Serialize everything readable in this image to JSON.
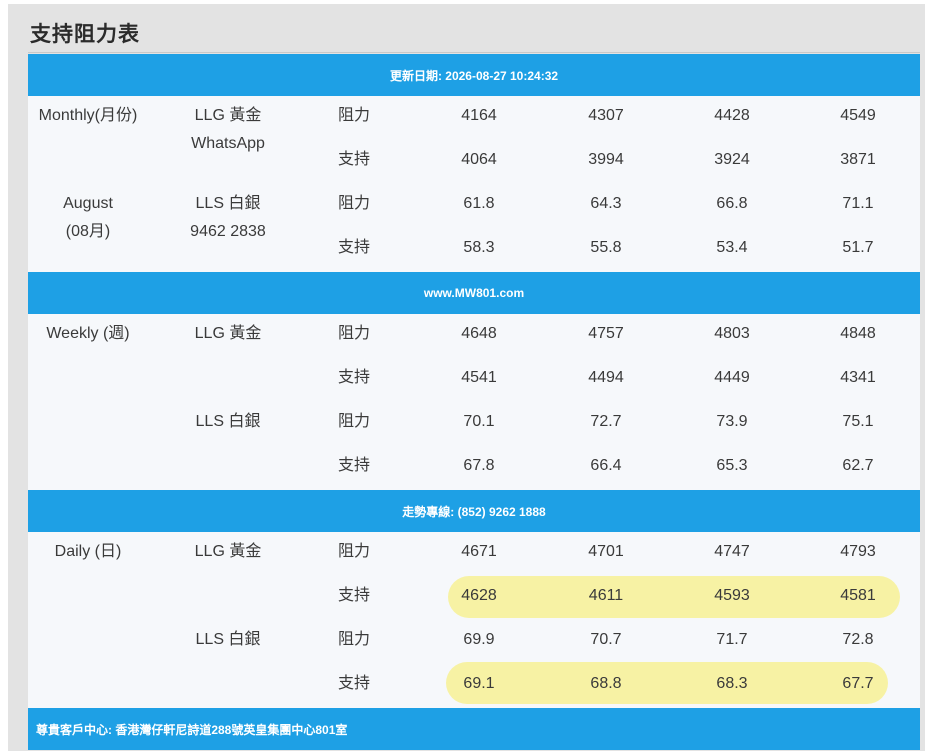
{
  "title": "支持阻力表",
  "banners": {
    "update": "更新日期: 2026-08-27 10:24:32",
    "website": "www.MW801.com",
    "hotline": "走勢專線: (852) 9262 1888",
    "address": "尊貴客戶中心: 香港灣仔軒尼詩道288號英皇集團中心801室"
  },
  "monthly": {
    "period_line1": "Monthly(月份)",
    "period_line2": "August",
    "period_line3": "(08月)",
    "gold_label": "LLG 黃金",
    "whatsapp_label": "WhatsApp",
    "silver_label": "LLS 白銀",
    "whatsapp_number": "9462 2838",
    "resistance_label": "阻力",
    "support_label": "支持",
    "gold_resistance": [
      "4164",
      "4307",
      "4428",
      "4549"
    ],
    "gold_support": [
      "4064",
      "3994",
      "3924",
      "3871"
    ],
    "silver_resistance": [
      "61.8",
      "64.3",
      "66.8",
      "71.1"
    ],
    "silver_support": [
      "58.3",
      "55.8",
      "53.4",
      "51.7"
    ]
  },
  "weekly": {
    "period": "Weekly (週)",
    "gold_label": "LLG 黃金",
    "silver_label": "LLS 白銀",
    "resistance_label": "阻力",
    "support_label": "支持",
    "gold_resistance": [
      "4648",
      "4757",
      "4803",
      "4848"
    ],
    "gold_support": [
      "4541",
      "4494",
      "4449",
      "4341"
    ],
    "silver_resistance": [
      "70.1",
      "72.7",
      "73.9",
      "75.1"
    ],
    "silver_support": [
      "67.8",
      "66.4",
      "65.3",
      "62.7"
    ]
  },
  "daily": {
    "period": "Daily (日)",
    "gold_label": "LLG 黃金",
    "silver_label": "LLS 白銀",
    "resistance_label": "阻力",
    "support_label": "支持",
    "gold_resistance": [
      "4671",
      "4701",
      "4747",
      "4793"
    ],
    "gold_support": [
      "4628",
      "4611",
      "4593",
      "4581"
    ],
    "silver_resistance": [
      "69.9",
      "70.7",
      "71.7",
      "72.8"
    ],
    "silver_support": [
      "69.1",
      "68.8",
      "68.3",
      "67.7"
    ]
  },
  "colors": {
    "banner": "#1ea0e5",
    "highlight": "#f7f2a4",
    "row_background": "#f6f8fb"
  }
}
